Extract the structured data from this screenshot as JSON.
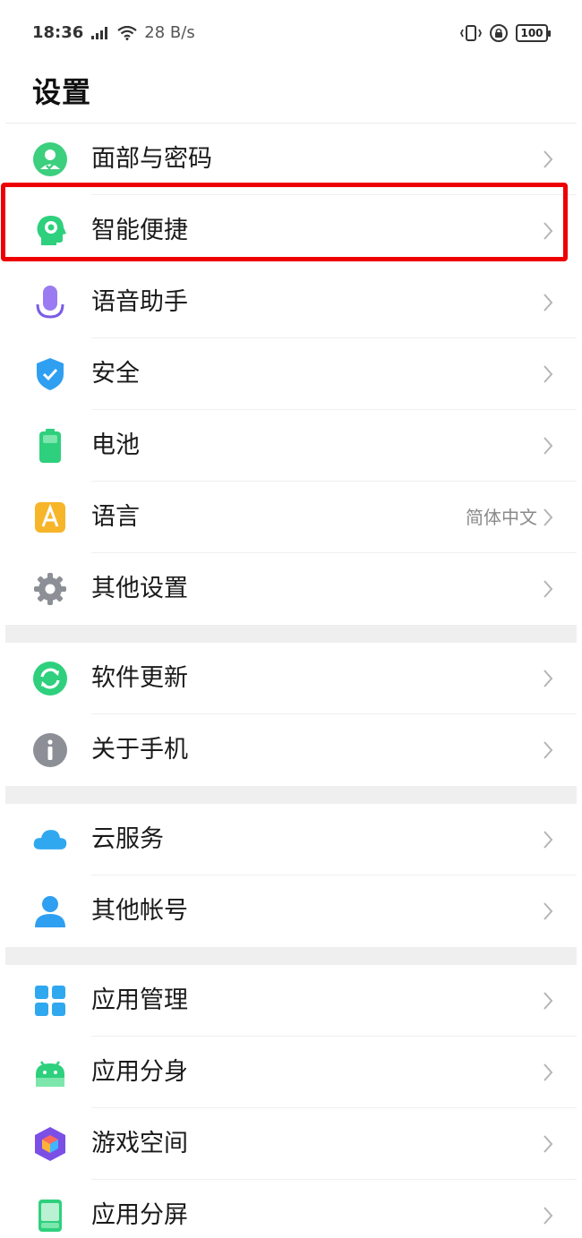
{
  "status_bar": {
    "time": "18:36",
    "network_speed": "28 B/s",
    "battery": "100"
  },
  "page": {
    "title": "设置"
  },
  "groups": [
    [
      {
        "id": "face-password",
        "label": "面部与密码",
        "icon": "face-password-icon",
        "color": "#3ccf7e",
        "highlighted": false
      },
      {
        "id": "smart-shortcut",
        "label": "智能便捷",
        "icon": "smart-head-icon",
        "color": "#2ed07d",
        "highlighted": true
      },
      {
        "id": "voice-assistant",
        "label": "语音助手",
        "icon": "microphone-icon",
        "color": "#8b6cf0",
        "highlighted": false
      },
      {
        "id": "security",
        "label": "安全",
        "icon": "shield-icon",
        "color": "#2f9ff2",
        "highlighted": false
      },
      {
        "id": "battery",
        "label": "电池",
        "icon": "battery-icon",
        "color": "#2ed07d",
        "highlighted": false
      },
      {
        "id": "language",
        "label": "语言",
        "value": "简体中文",
        "icon": "language-icon",
        "color": "#f7b52a",
        "highlighted": false
      },
      {
        "id": "other-settings",
        "label": "其他设置",
        "icon": "gear-icon",
        "color": "#8c8f96",
        "highlighted": false
      }
    ],
    [
      {
        "id": "software-update",
        "label": "软件更新",
        "icon": "update-icon",
        "color": "#2ed07d",
        "highlighted": false
      },
      {
        "id": "about-phone",
        "label": "关于手机",
        "icon": "info-icon",
        "color": "#8c8f96",
        "highlighted": false
      }
    ],
    [
      {
        "id": "cloud-service",
        "label": "云服务",
        "icon": "cloud-icon",
        "color": "#2fa8f0",
        "highlighted": false
      },
      {
        "id": "other-accounts",
        "label": "其他帐号",
        "icon": "person-icon",
        "color": "#2f9ff2",
        "highlighted": false
      }
    ],
    [
      {
        "id": "app-management",
        "label": "应用管理",
        "icon": "app-grid-icon",
        "color": "#2fa8f0",
        "highlighted": false
      },
      {
        "id": "app-clone",
        "label": "应用分身",
        "icon": "android-icon",
        "color": "#2ed07d",
        "highlighted": false
      },
      {
        "id": "game-space",
        "label": "游戏空间",
        "icon": "game-cube-icon",
        "color": "#7b4fe6",
        "highlighted": false
      },
      {
        "id": "split-screen",
        "label": "应用分屏",
        "icon": "split-screen-icon",
        "color": "#2ed07d",
        "highlighted": false
      }
    ]
  ]
}
